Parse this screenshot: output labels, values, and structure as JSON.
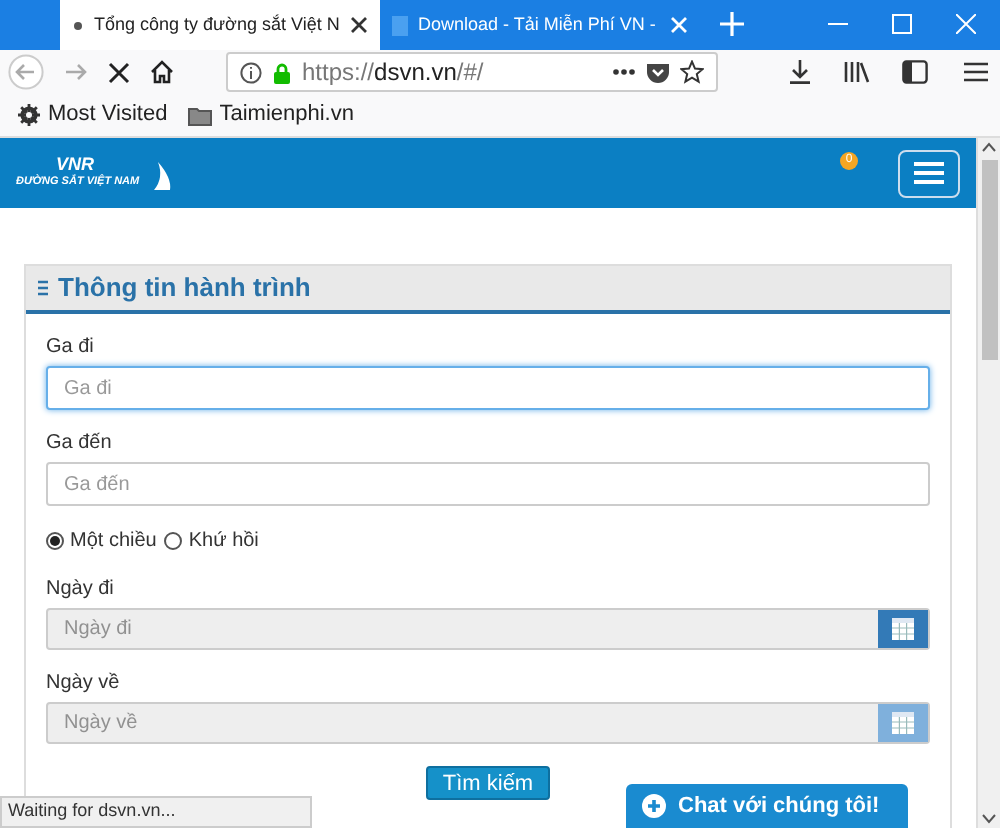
{
  "browser": {
    "tabs": [
      {
        "title": "Tổng công ty đường sắt Việt N",
        "selected": true
      },
      {
        "title": "Download - Tải Miễn Phí VN -",
        "selected": false
      }
    ],
    "url": {
      "scheme": "https://",
      "host": "dsvn.vn",
      "path": "/#/"
    },
    "bookmarks": [
      {
        "kind": "gear",
        "label": "Most Visited"
      },
      {
        "kind": "folder",
        "label": "Taimienphi.vn"
      }
    ],
    "status_bar": "Waiting for dsvn.vn..."
  },
  "header": {
    "logo_mark": "VNR",
    "logo_text": "ĐƯỜNG SẮT VIỆT NAM",
    "notification_count": "0"
  },
  "panel": {
    "title": "Thông tin hành trình",
    "fields": [
      {
        "kind": "text",
        "label": "Ga đi",
        "placeholder": "Ga đi",
        "focused": true
      },
      {
        "kind": "text",
        "label": "Ga đến",
        "placeholder": "Ga đến",
        "focused": false
      },
      {
        "kind": "radios",
        "options": [
          {
            "label": "Một chiều",
            "selected": true
          },
          {
            "label": "Khứ hồi",
            "selected": false
          }
        ]
      },
      {
        "kind": "date",
        "label": "Ngày đi",
        "placeholder": "Ngày đi",
        "disabled": false
      },
      {
        "kind": "date",
        "label": "Ngày về",
        "placeholder": "Ngày về",
        "disabled": true
      }
    ],
    "button": "Tìm kiếm"
  },
  "chat_button": "Chat với chúng tôi!"
}
